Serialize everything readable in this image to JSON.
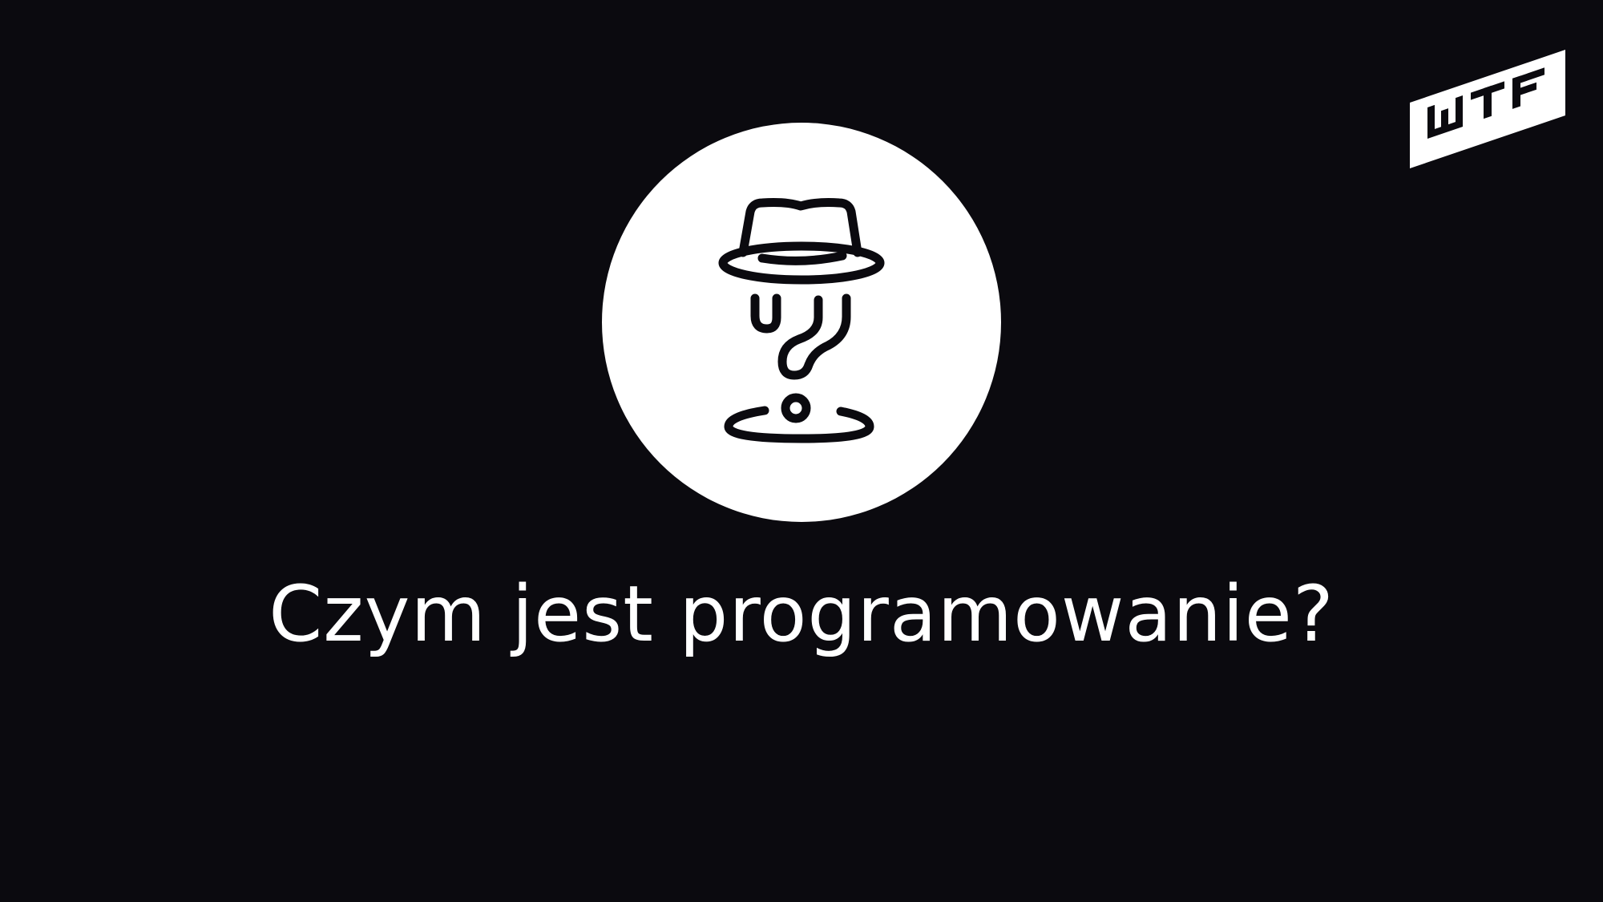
{
  "slide": {
    "title": "Czym jest programowanie?",
    "background_color": "#0b0a0f",
    "text_color": "#ffffff"
  },
  "logo": {
    "text": "WTF",
    "icon": "wtf-logo-icon"
  },
  "emblem": {
    "icon": "mystery-hat-question-mark-icon",
    "circle_color": "#ffffff",
    "line_color": "#0b0a0f"
  }
}
